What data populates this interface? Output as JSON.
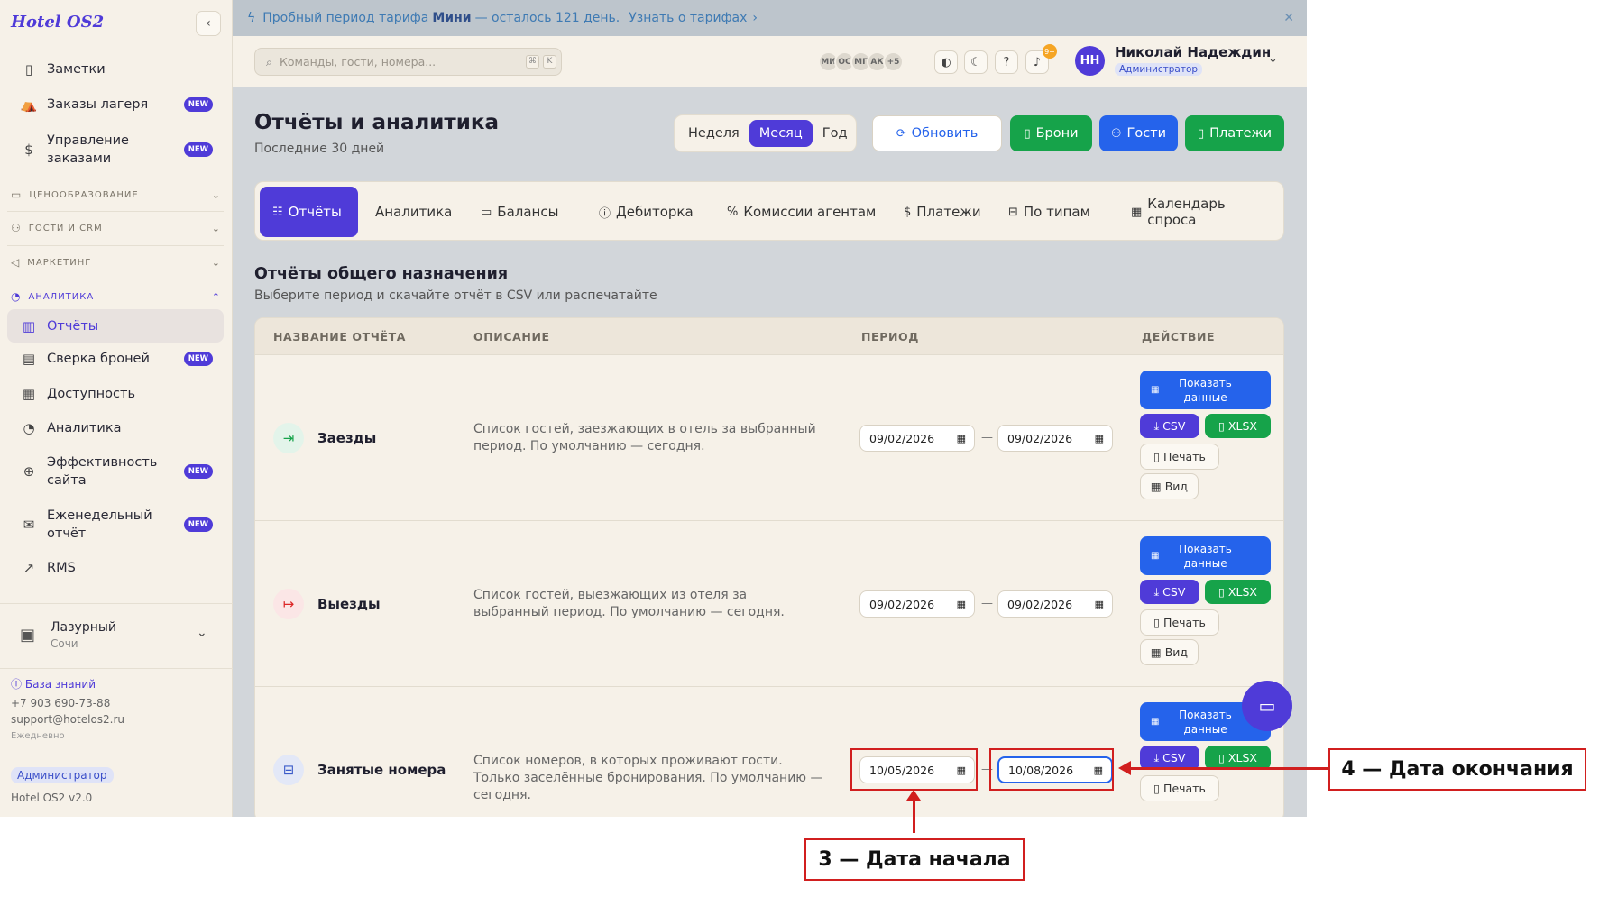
{
  "brand": "Hotel OS2",
  "sidebar": {
    "items": [
      {
        "label": "Заметки",
        "icon": "note-icon"
      },
      {
        "label": "Заказы лагеря",
        "icon": "camp-icon",
        "badge": "NEW"
      },
      {
        "label": "Управление заказами",
        "icon": "dollar-icon",
        "badge": "NEW"
      }
    ],
    "sections": [
      {
        "label": "ЦЕНООБРАЗОВАНИЕ"
      },
      {
        "label": "ГОСТИ И CRM"
      },
      {
        "label": "МАРКЕТИНГ"
      },
      {
        "label": "АНАЛИТИКА"
      }
    ],
    "analytics_items": [
      {
        "label": "Отчёты"
      },
      {
        "label": "Сверка броней",
        "badge": "NEW"
      },
      {
        "label": "Доступность"
      },
      {
        "label": "Аналитика"
      },
      {
        "label": "Эффективность сайта",
        "badge": "NEW"
      },
      {
        "label": "Еженедельный отчёт",
        "badge": "NEW"
      },
      {
        "label": "RMS"
      }
    ],
    "hotel": {
      "name": "Лазурный",
      "city": "Сочи"
    },
    "kb_link": "База знаний",
    "phone": "+7 903 690-73-88",
    "email": "support@hotelos2.ru",
    "schedule": "Ежедневно",
    "role_badge": "Администратор",
    "version": "Hotel OS2 v2.0"
  },
  "banner": {
    "text1": "Пробный период тарифа",
    "plan": "Мини",
    "text2": "— осталось 121 день.",
    "link": "Узнать о тарифах"
  },
  "topbar": {
    "search_placeholder": "Команды, гости, номера...",
    "kbd1": "⌘",
    "kbd2": "K",
    "avatars": [
      "МИ",
      "ОС",
      "МГ",
      "АК",
      "+5"
    ],
    "notif_count": "9+",
    "user_initials": "НН",
    "user_name": "Николай Надеждин",
    "user_role": "Администратор"
  },
  "page": {
    "title": "Отчёты и аналитика",
    "subtitle": "Последние 30 дней",
    "periods": [
      "Неделя",
      "Месяц",
      "Год"
    ],
    "active_period": "Месяц",
    "refresh": "Обновить",
    "btn_bookings": "Брони",
    "btn_guests": "Гости",
    "btn_payments": "Платежи"
  },
  "tabs": [
    "Отчёты",
    "Аналитика",
    "Балансы",
    "Дебиторка",
    "Комиссии агентам",
    "Платежи",
    "По типам",
    "Календарь спроса"
  ],
  "section": {
    "title": "Отчёты общего назначения",
    "subtitle": "Выберите период и скачайте отчёт в CSV или распечатайте"
  },
  "table": {
    "headers": [
      "НАЗВАНИЕ ОТЧЁТА",
      "ОПИСАНИЕ",
      "ПЕРИОД",
      "ДЕЙСТВИЕ"
    ],
    "rows": [
      {
        "name": "Заезды",
        "desc": "Список гостей, заезжающих в отель за выбранный период. По умолчанию — сегодня.",
        "from": "09/02/2026",
        "to": "09/02/2026"
      },
      {
        "name": "Выезды",
        "desc": "Список гостей, выезжающих из отеля за выбранный период. По умолчанию — сегодня.",
        "from": "09/02/2026",
        "to": "09/02/2026"
      },
      {
        "name": "Занятые номера",
        "desc": "Список номеров, в которых проживают гости. Только заселённые бронирования. По умолчанию — сегодня.",
        "from": "10/05/2026",
        "to": "10/08/2026"
      }
    ],
    "actions": {
      "show": "Показать данные",
      "csv": "CSV",
      "xlsx": "XLSX",
      "print": "Печать",
      "view": "Вид"
    }
  },
  "annotations": {
    "start": "3 — Дата начала",
    "end": "4 — Дата окончания"
  },
  "colors": {
    "accent": "#4f3bd8",
    "blue": "#2563eb",
    "green": "#16a34a",
    "annotation": "#d11f1f"
  }
}
